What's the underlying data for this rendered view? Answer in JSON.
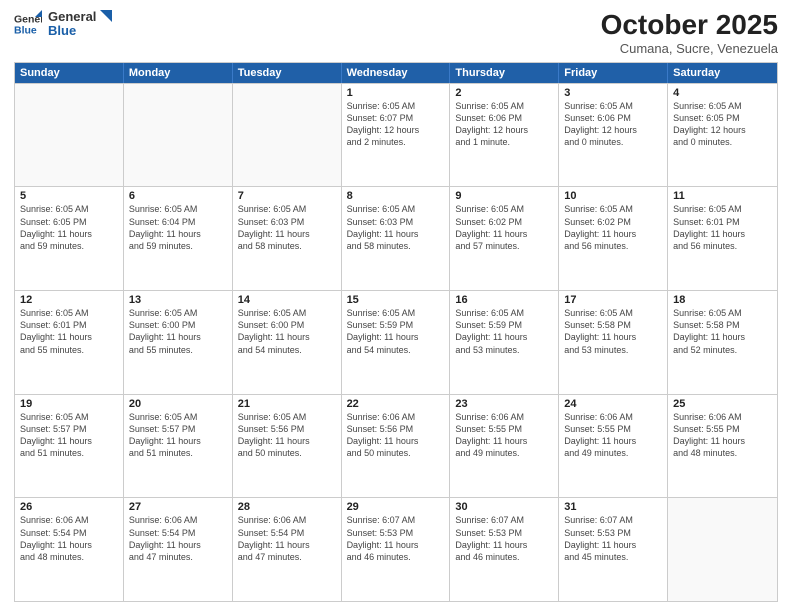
{
  "header": {
    "logo_line1": "General",
    "logo_line2": "Blue",
    "title": "October 2025",
    "subtitle": "Cumana, Sucre, Venezuela"
  },
  "days": [
    "Sunday",
    "Monday",
    "Tuesday",
    "Wednesday",
    "Thursday",
    "Friday",
    "Saturday"
  ],
  "rows": [
    [
      {
        "day": "",
        "text": ""
      },
      {
        "day": "",
        "text": ""
      },
      {
        "day": "",
        "text": ""
      },
      {
        "day": "1",
        "text": "Sunrise: 6:05 AM\nSunset: 6:07 PM\nDaylight: 12 hours\nand 2 minutes."
      },
      {
        "day": "2",
        "text": "Sunrise: 6:05 AM\nSunset: 6:06 PM\nDaylight: 12 hours\nand 1 minute."
      },
      {
        "day": "3",
        "text": "Sunrise: 6:05 AM\nSunset: 6:06 PM\nDaylight: 12 hours\nand 0 minutes."
      },
      {
        "day": "4",
        "text": "Sunrise: 6:05 AM\nSunset: 6:05 PM\nDaylight: 12 hours\nand 0 minutes."
      }
    ],
    [
      {
        "day": "5",
        "text": "Sunrise: 6:05 AM\nSunset: 6:05 PM\nDaylight: 11 hours\nand 59 minutes."
      },
      {
        "day": "6",
        "text": "Sunrise: 6:05 AM\nSunset: 6:04 PM\nDaylight: 11 hours\nand 59 minutes."
      },
      {
        "day": "7",
        "text": "Sunrise: 6:05 AM\nSunset: 6:03 PM\nDaylight: 11 hours\nand 58 minutes."
      },
      {
        "day": "8",
        "text": "Sunrise: 6:05 AM\nSunset: 6:03 PM\nDaylight: 11 hours\nand 58 minutes."
      },
      {
        "day": "9",
        "text": "Sunrise: 6:05 AM\nSunset: 6:02 PM\nDaylight: 11 hours\nand 57 minutes."
      },
      {
        "day": "10",
        "text": "Sunrise: 6:05 AM\nSunset: 6:02 PM\nDaylight: 11 hours\nand 56 minutes."
      },
      {
        "day": "11",
        "text": "Sunrise: 6:05 AM\nSunset: 6:01 PM\nDaylight: 11 hours\nand 56 minutes."
      }
    ],
    [
      {
        "day": "12",
        "text": "Sunrise: 6:05 AM\nSunset: 6:01 PM\nDaylight: 11 hours\nand 55 minutes."
      },
      {
        "day": "13",
        "text": "Sunrise: 6:05 AM\nSunset: 6:00 PM\nDaylight: 11 hours\nand 55 minutes."
      },
      {
        "day": "14",
        "text": "Sunrise: 6:05 AM\nSunset: 6:00 PM\nDaylight: 11 hours\nand 54 minutes."
      },
      {
        "day": "15",
        "text": "Sunrise: 6:05 AM\nSunset: 5:59 PM\nDaylight: 11 hours\nand 54 minutes."
      },
      {
        "day": "16",
        "text": "Sunrise: 6:05 AM\nSunset: 5:59 PM\nDaylight: 11 hours\nand 53 minutes."
      },
      {
        "day": "17",
        "text": "Sunrise: 6:05 AM\nSunset: 5:58 PM\nDaylight: 11 hours\nand 53 minutes."
      },
      {
        "day": "18",
        "text": "Sunrise: 6:05 AM\nSunset: 5:58 PM\nDaylight: 11 hours\nand 52 minutes."
      }
    ],
    [
      {
        "day": "19",
        "text": "Sunrise: 6:05 AM\nSunset: 5:57 PM\nDaylight: 11 hours\nand 51 minutes."
      },
      {
        "day": "20",
        "text": "Sunrise: 6:05 AM\nSunset: 5:57 PM\nDaylight: 11 hours\nand 51 minutes."
      },
      {
        "day": "21",
        "text": "Sunrise: 6:05 AM\nSunset: 5:56 PM\nDaylight: 11 hours\nand 50 minutes."
      },
      {
        "day": "22",
        "text": "Sunrise: 6:06 AM\nSunset: 5:56 PM\nDaylight: 11 hours\nand 50 minutes."
      },
      {
        "day": "23",
        "text": "Sunrise: 6:06 AM\nSunset: 5:55 PM\nDaylight: 11 hours\nand 49 minutes."
      },
      {
        "day": "24",
        "text": "Sunrise: 6:06 AM\nSunset: 5:55 PM\nDaylight: 11 hours\nand 49 minutes."
      },
      {
        "day": "25",
        "text": "Sunrise: 6:06 AM\nSunset: 5:55 PM\nDaylight: 11 hours\nand 48 minutes."
      }
    ],
    [
      {
        "day": "26",
        "text": "Sunrise: 6:06 AM\nSunset: 5:54 PM\nDaylight: 11 hours\nand 48 minutes."
      },
      {
        "day": "27",
        "text": "Sunrise: 6:06 AM\nSunset: 5:54 PM\nDaylight: 11 hours\nand 47 minutes."
      },
      {
        "day": "28",
        "text": "Sunrise: 6:06 AM\nSunset: 5:54 PM\nDaylight: 11 hours\nand 47 minutes."
      },
      {
        "day": "29",
        "text": "Sunrise: 6:07 AM\nSunset: 5:53 PM\nDaylight: 11 hours\nand 46 minutes."
      },
      {
        "day": "30",
        "text": "Sunrise: 6:07 AM\nSunset: 5:53 PM\nDaylight: 11 hours\nand 46 minutes."
      },
      {
        "day": "31",
        "text": "Sunrise: 6:07 AM\nSunset: 5:53 PM\nDaylight: 11 hours\nand 45 minutes."
      },
      {
        "day": "",
        "text": ""
      }
    ]
  ]
}
